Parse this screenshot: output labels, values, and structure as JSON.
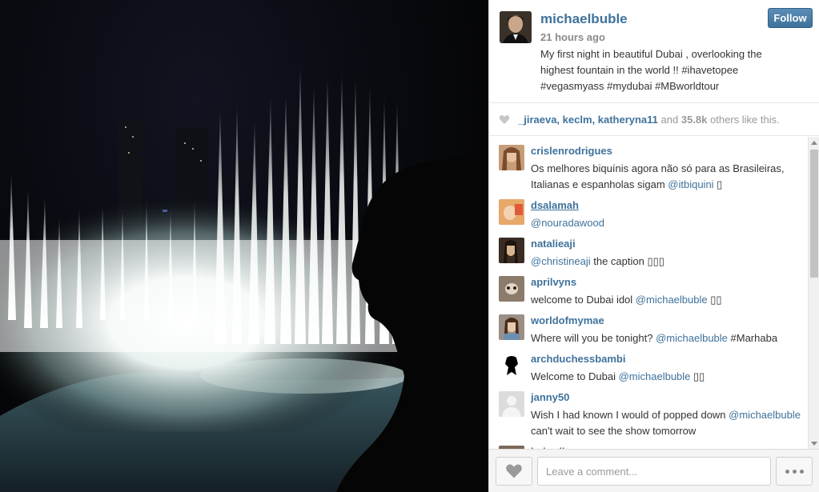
{
  "post": {
    "username": "michaelbuble",
    "time": "21 hours ago",
    "caption": "My first night in beautiful Dubai , overlooking the highest fountain in the world !! #ihavetopee #vegasmyass #mydubai #MBworldtour",
    "follow_label": "Follow"
  },
  "likes": {
    "likers": "_jiraeva, keclm, katheryna11",
    "and": "and",
    "count": "35.8k",
    "suffix": "others like this."
  },
  "comments": [
    {
      "user": "crislenrodrigues",
      "parts": [
        {
          "t": "Os melhores biquínis agora não só para as Brasileiras, Italianas e espanholas sigam "
        },
        {
          "m": "@itbiquini"
        },
        {
          "t": " ▯"
        }
      ]
    },
    {
      "user": "dsalamah",
      "parts": [
        {
          "m": "@nouradawood"
        }
      ]
    },
    {
      "user": "natalieaji",
      "parts": [
        {
          "m": "@christineaji"
        },
        {
          "t": " the caption ▯▯▯"
        }
      ]
    },
    {
      "user": "aprilvyns",
      "parts": [
        {
          "t": "welcome to Dubai idol "
        },
        {
          "m": "@michaelbuble"
        },
        {
          "t": " ▯▯"
        }
      ]
    },
    {
      "user": "worldofmymae",
      "parts": [
        {
          "t": "Where will you be tonight? "
        },
        {
          "m": "@michaelbuble"
        },
        {
          "t": " #Marhaba"
        }
      ]
    },
    {
      "user": "archduchessbambi",
      "parts": [
        {
          "t": "Welcome to Dubai "
        },
        {
          "m": "@michaelbuble"
        },
        {
          "t": " ▯▯"
        }
      ]
    },
    {
      "user": "janny50",
      "parts": [
        {
          "t": "Wish I had known I would of popped down "
        },
        {
          "m": "@michaelbuble"
        },
        {
          "t": " can't wait to see the show tomorrow"
        }
      ]
    },
    {
      "user": "hairydi",
      "parts": []
    }
  ],
  "footer": {
    "comment_placeholder": "Leave a comment..."
  },
  "colors": {
    "link": "#3f729b",
    "follow_button": "#3f729b"
  },
  "icons": {
    "like": "heart-icon",
    "more": "ellipsis-icon"
  }
}
